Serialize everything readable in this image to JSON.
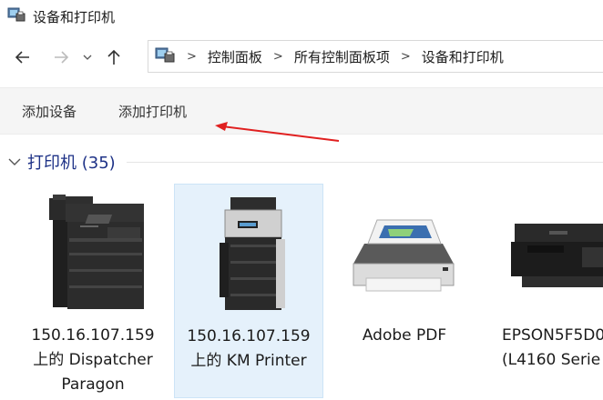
{
  "window": {
    "title": "设备和打印机"
  },
  "breadcrumb": [
    "控制面板",
    "所有控制面板项",
    "设备和打印机"
  ],
  "toolbar": {
    "add_device": "添加设备",
    "add_printer": "添加打印机"
  },
  "section": {
    "title": "打印机 (35)"
  },
  "devices": [
    {
      "line1": "150.16.107.159",
      "line2": "上的 Dispatcher",
      "line3": "Paragon"
    },
    {
      "line1": "150.16.107.159",
      "line2": "上的 KM Printer",
      "line3": ""
    },
    {
      "line1": "Adobe PDF",
      "line2": "",
      "line3": ""
    },
    {
      "line1": "EPSON5F5D0",
      "line2": "(L4160 Serie",
      "line3": ""
    }
  ],
  "colors": {
    "accent": "#1e3287",
    "selected_bg": "#e5f1fb",
    "arrow": "#e02020"
  }
}
